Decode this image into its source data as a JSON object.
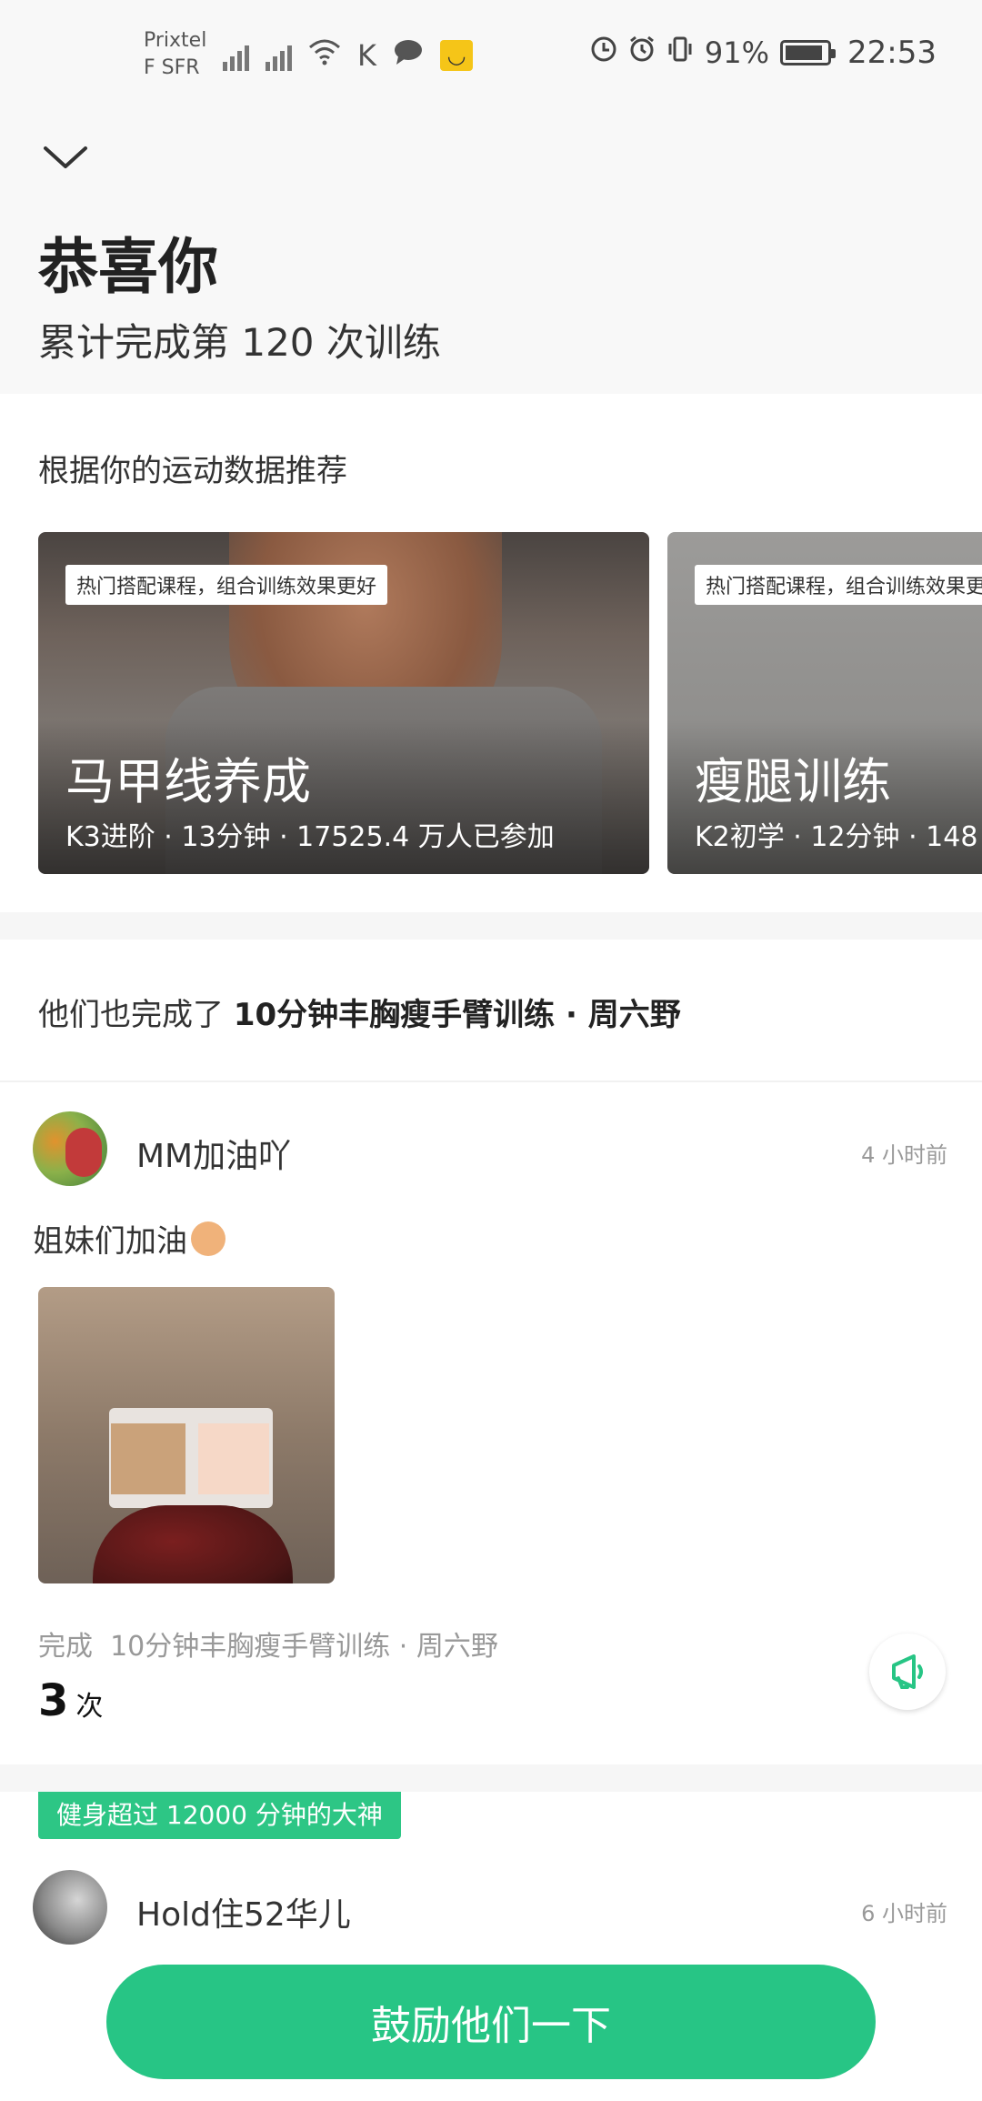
{
  "status_bar": {
    "carrier_line1": "Prixtel",
    "carrier_line2": "F SFR",
    "battery_percent": "91%",
    "battery_level": 0.91,
    "time": "22:53",
    "icons": [
      "signal-icon",
      "signal-roaming-icon",
      "wifi-icon",
      "k-app-icon",
      "chat-icon",
      "smile-app-icon",
      "data-saver-icon",
      "alarm-icon",
      "vibrate-icon",
      "battery-icon"
    ]
  },
  "header": {
    "collapse_icon": "chevron-down-icon",
    "title": "恭喜你",
    "subtitle": "累计完成第 120 次训练"
  },
  "recommendations": {
    "label": "根据你的运动数据推荐",
    "cards": [
      {
        "tag": "热门搭配课程，组合训练效果更好",
        "title": "马甲线养成",
        "meta": "K3进阶 · 13分钟 · 17525.4 万人已参加"
      },
      {
        "tag": "热门搭配课程，组合训练效果更",
        "title": "瘦腿训练",
        "meta": "K2初学 · 12分钟 · 148"
      }
    ]
  },
  "also_completed": {
    "prefix": "他们也完成了 ",
    "course": "10分钟丰胸瘦手臂训练 · 周六野"
  },
  "posts": [
    {
      "username": "MM加油吖",
      "time_ago": "4 小时前",
      "text": "姐妹们加油",
      "completed_label": "完成",
      "completed_course": "10分钟丰胸瘦手臂训练 · 周六野",
      "count": "3",
      "count_unit": "次"
    },
    {
      "badge": "健身超过 12000 分钟的大神",
      "username": "Hold住52华儿",
      "time_ago": "6 小时前"
    }
  ],
  "cta": {
    "label": "鼓励他们一下"
  },
  "colors": {
    "accent": "#27c585",
    "header_bg": "#f8f8f8"
  }
}
